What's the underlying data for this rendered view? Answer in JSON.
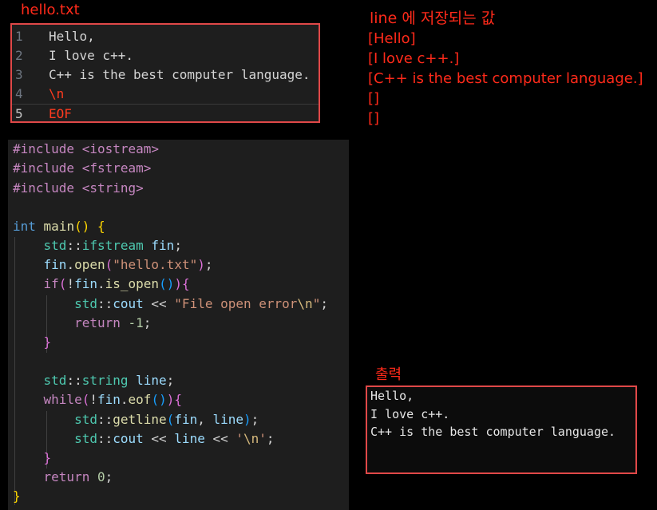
{
  "file": {
    "title": "hello.txt",
    "lines": [
      {
        "num": "1",
        "text": "Hello,"
      },
      {
        "num": "2",
        "text": "I love c++."
      },
      {
        "num": "3",
        "text": "C++ is the best computer language."
      },
      {
        "num": "4",
        "text": "\\n"
      },
      {
        "num": "5",
        "text": "EOF"
      }
    ]
  },
  "line_values": {
    "title": "line 에 저장되는 값",
    "items": [
      "[Hello]",
      "[I love c++.]",
      "[C++ is the best computer language.]",
      "[]",
      "[]"
    ]
  },
  "code": {
    "include1": "#include <iostream>",
    "include2": "#include <fstream>",
    "include3": "#include <string>",
    "int_kw": "int",
    "main_fn": "main",
    "paren_open_close": "()",
    "brace": "{",
    "std": "std",
    "sep": "::",
    "ifstream": "ifstream",
    "fin": "fin",
    "dot": ".",
    "open": "open",
    "hello_txt_str": "\"hello.txt\"",
    "semicolon": ";",
    "if_kw": "if",
    "not": "!",
    "is_open": "is_open",
    "cout": "cout",
    "shift": " << ",
    "err_str_a": "\"File open error",
    "err_esc": "\\n",
    "err_str_b": "\"",
    "return_kw": "return",
    "neg_one": "-1",
    "close_brace": "}",
    "string_type": "string",
    "line_var": "line",
    "while_kw": "while",
    "eof": "eof",
    "getline": "getline",
    "comma": ", ",
    "newline_char_a": "'",
    "newline_char_b": "'",
    "zero": "0"
  },
  "output": {
    "title": "출력",
    "lines": [
      "Hello,",
      "I love c++.",
      "C++ is the best computer language."
    ]
  },
  "colors": {
    "annotation_red": "#ff2a1a",
    "box_border": "#e04848",
    "editor_bg": "#1e1e1e"
  }
}
